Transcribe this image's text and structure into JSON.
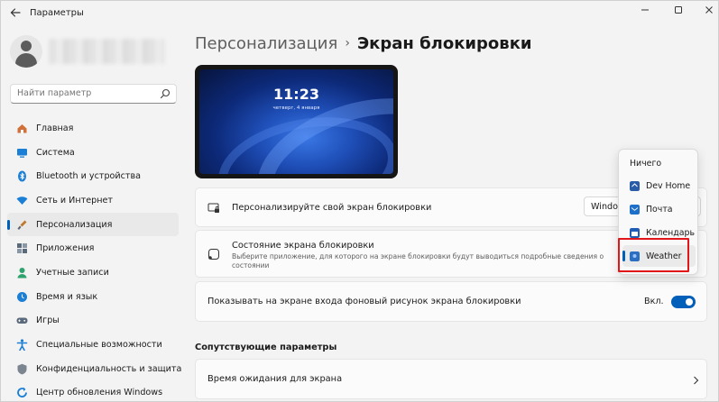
{
  "window": {
    "title": "Параметры"
  },
  "search": {
    "placeholder": "Найти параметр"
  },
  "sidebar": {
    "items": [
      {
        "label": "Главная",
        "icon": "home-icon",
        "color": "#d0703a"
      },
      {
        "label": "Система",
        "icon": "system-icon",
        "color": "#1c7fd6"
      },
      {
        "label": "Bluetooth и устройства",
        "icon": "bluetooth-icon",
        "color": "#1c7fd6"
      },
      {
        "label": "Сеть и Интернет",
        "icon": "wifi-icon",
        "color": "#1c7fd6"
      },
      {
        "label": "Персонализация",
        "icon": "brush-icon",
        "color": "#c07a2e",
        "active": true
      },
      {
        "label": "Приложения",
        "icon": "apps-icon",
        "color": "#5a6a7a"
      },
      {
        "label": "Учетные записи",
        "icon": "account-icon",
        "color": "#2ea36d"
      },
      {
        "label": "Время и язык",
        "icon": "globe-time-icon",
        "color": "#1c7fd6"
      },
      {
        "label": "Игры",
        "icon": "gamepad-icon",
        "color": "#5a6a7a"
      },
      {
        "label": "Специальные возможности",
        "icon": "accessibility-icon",
        "color": "#1c7fd6"
      },
      {
        "label": "Конфиденциальность и защита",
        "icon": "shield-icon",
        "color": "#7a8590"
      },
      {
        "label": "Центр обновления Windows",
        "icon": "update-icon",
        "color": "#1c7fd6"
      }
    ]
  },
  "breadcrumb": {
    "parent": "Персонализация",
    "separator": "›",
    "current": "Экран блокировки"
  },
  "preview": {
    "time": "11:23",
    "date": "четверг, 4 января"
  },
  "cards": {
    "personalize": {
      "title": "Персонализируйте свой экран блокировки",
      "dropdown_value": "Window"
    },
    "status": {
      "title": "Состояние экрана блокировки",
      "description": "Выберите приложение, для которого на экране блокировки будут выводиться подробные сведения о состоянии"
    },
    "signin_bg": {
      "title": "Показывать на экране входа фоновый рисунок экрана блокировки",
      "toggle_label": "Вкл."
    }
  },
  "related": {
    "title": "Сопутствующие параметры",
    "items": [
      {
        "label": "Время ожидания для экрана"
      }
    ]
  },
  "flyout": {
    "items": [
      {
        "label": "Ничего",
        "icon": ""
      },
      {
        "label": "Dev Home",
        "icon": "dev-home-icon",
        "color": "#2a5ca8"
      },
      {
        "label": "Почта",
        "icon": "mail-icon",
        "color": "#1d6fc9"
      },
      {
        "label": "Календарь",
        "icon": "calendar-icon",
        "color": "#1f5eb4"
      },
      {
        "label": "Weather",
        "icon": "weather-icon",
        "color": "#2c6ec0",
        "selected": true
      }
    ]
  },
  "colors": {
    "accent": "#005fb8",
    "highlight": "#e0161b"
  }
}
